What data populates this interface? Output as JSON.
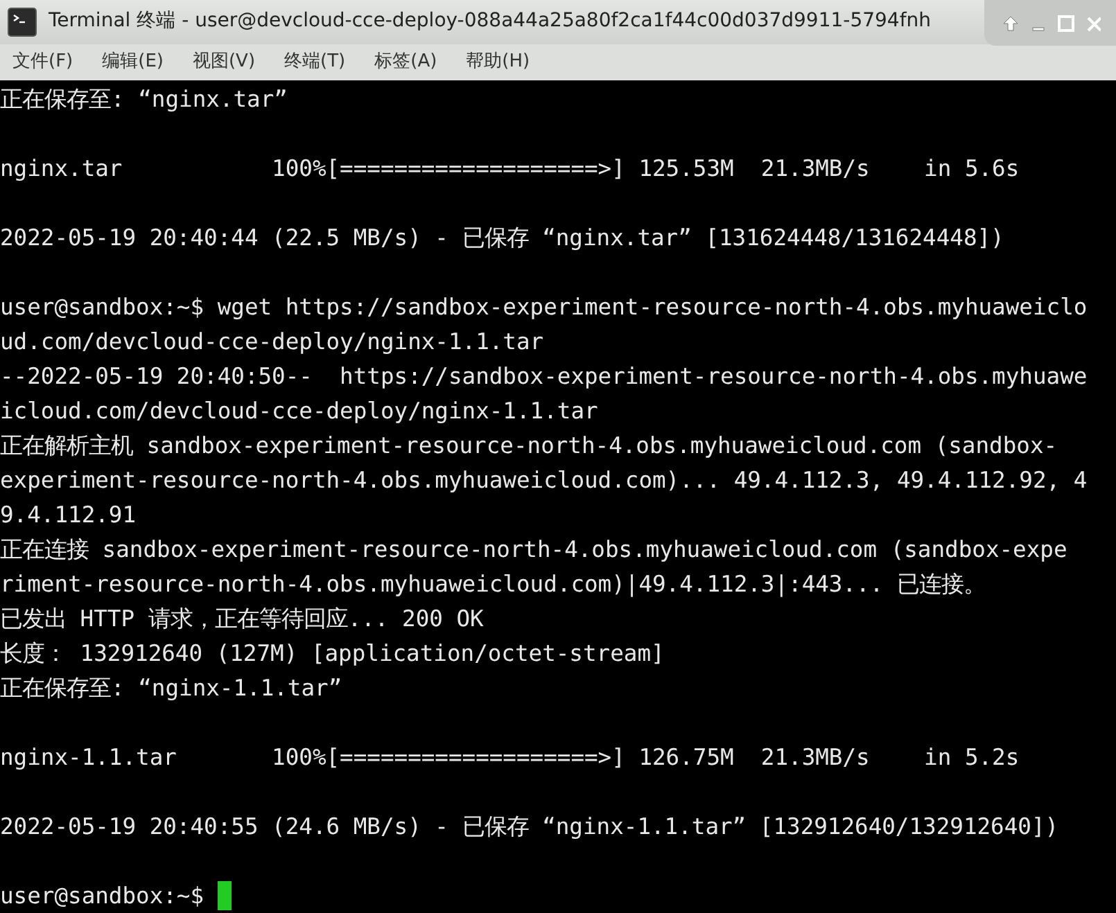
{
  "window": {
    "title": "Terminal 终端 - user@devcloud-cce-deploy-088a44a25a80f2ca1f44c00d037d9911-5794fnh"
  },
  "menu": [
    "文件(F)",
    "编辑(E)",
    "视图(V)",
    "终端(T)",
    "标签(A)",
    "帮助(H)"
  ],
  "terminal": {
    "lines": [
      {
        "kind": "text",
        "text": "正在保存至: “nginx.tar”"
      },
      {
        "kind": "blank"
      },
      {
        "kind": "text",
        "text": "nginx.tar           100%[===================>] 125.53M  21.3MB/s    in 5.6s"
      },
      {
        "kind": "blank"
      },
      {
        "kind": "text",
        "text": "2022-05-19 20:40:44 (22.5 MB/s) - 已保存 “nginx.tar” [131624448/131624448])"
      },
      {
        "kind": "blank"
      },
      {
        "kind": "text",
        "text": "user@sandbox:~$ wget https://sandbox-experiment-resource-north-4.obs.myhuaweiclo"
      },
      {
        "kind": "text",
        "text": "ud.com/devcloud-cce-deploy/nginx-1.1.tar"
      },
      {
        "kind": "text",
        "text": "--2022-05-19 20:40:50--  https://sandbox-experiment-resource-north-4.obs.myhuawe"
      },
      {
        "kind": "text",
        "text": "icloud.com/devcloud-cce-deploy/nginx-1.1.tar"
      },
      {
        "kind": "text",
        "text": "正在解析主机 sandbox-experiment-resource-north-4.obs.myhuaweicloud.com (sandbox-"
      },
      {
        "kind": "text",
        "text": "experiment-resource-north-4.obs.myhuaweicloud.com)... 49.4.112.3, 49.4.112.92, 4"
      },
      {
        "kind": "text",
        "text": "9.4.112.91"
      },
      {
        "kind": "text",
        "text": "正在连接 sandbox-experiment-resource-north-4.obs.myhuaweicloud.com (sandbox-expe"
      },
      {
        "kind": "text",
        "text": "riment-resource-north-4.obs.myhuaweicloud.com)|49.4.112.3|:443... 已连接。"
      },
      {
        "kind": "text",
        "text": "已发出 HTTP 请求，正在等待回应... 200 OK"
      },
      {
        "kind": "text",
        "text": "长度： 132912640 (127M) [application/octet-stream]"
      },
      {
        "kind": "text",
        "text": "正在保存至: “nginx-1.1.tar”"
      },
      {
        "kind": "blank"
      },
      {
        "kind": "text",
        "text": "nginx-1.1.tar       100%[===================>] 126.75M  21.3MB/s    in 5.2s"
      },
      {
        "kind": "blank"
      },
      {
        "kind": "text",
        "text": "2022-05-19 20:40:55 (24.6 MB/s) - 已保存 “nginx-1.1.tar” [132912640/132912640])"
      },
      {
        "kind": "blank"
      },
      {
        "kind": "prompt",
        "text": "user@sandbox:~$",
        "cursor": true
      }
    ]
  }
}
